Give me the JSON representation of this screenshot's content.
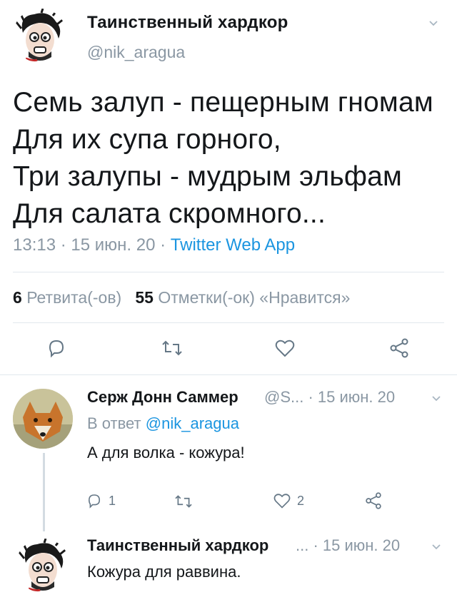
{
  "main_tweet": {
    "author_name": "Таинственный хардкор",
    "handle": "@nik_aragua",
    "text": "Семь залуп - пещерным гномам\nДля их супа горного,\nТри залупы - мудрым эльфам\nДля салата скромного...",
    "time": "13:13",
    "sep1": " · ",
    "date": "15 июн. 20",
    "sep2": " · ",
    "source": "Twitter Web App",
    "retweets_count": "6",
    "retweets_label": "Ретвита(-ов)",
    "likes_count": "55",
    "likes_label": "Отметки(-ок) «Нравится»"
  },
  "replies": [
    {
      "author_name": "Серж Донн Саммер",
      "handle": "@S...",
      "date": " · 15 июн. 20",
      "reply_prefix": "В ответ",
      "reply_to": "@nik_aragua",
      "text": "А для волка - кожура!",
      "reply_count": "1",
      "like_count": "2"
    },
    {
      "author_name": "Таинственный хардкор",
      "handle": "...",
      "date": " · 15 июн. 20",
      "text": "Кожура для раввина."
    }
  ],
  "icons": [
    "chevron-down-icon",
    "reply-icon",
    "retweet-icon",
    "like-icon",
    "share-icon"
  ],
  "colors": {
    "text": "#14171a",
    "muted": "#8a97a3",
    "link": "#1b95e0",
    "divider": "#e1e8ed",
    "thread": "#d3dbe2"
  }
}
